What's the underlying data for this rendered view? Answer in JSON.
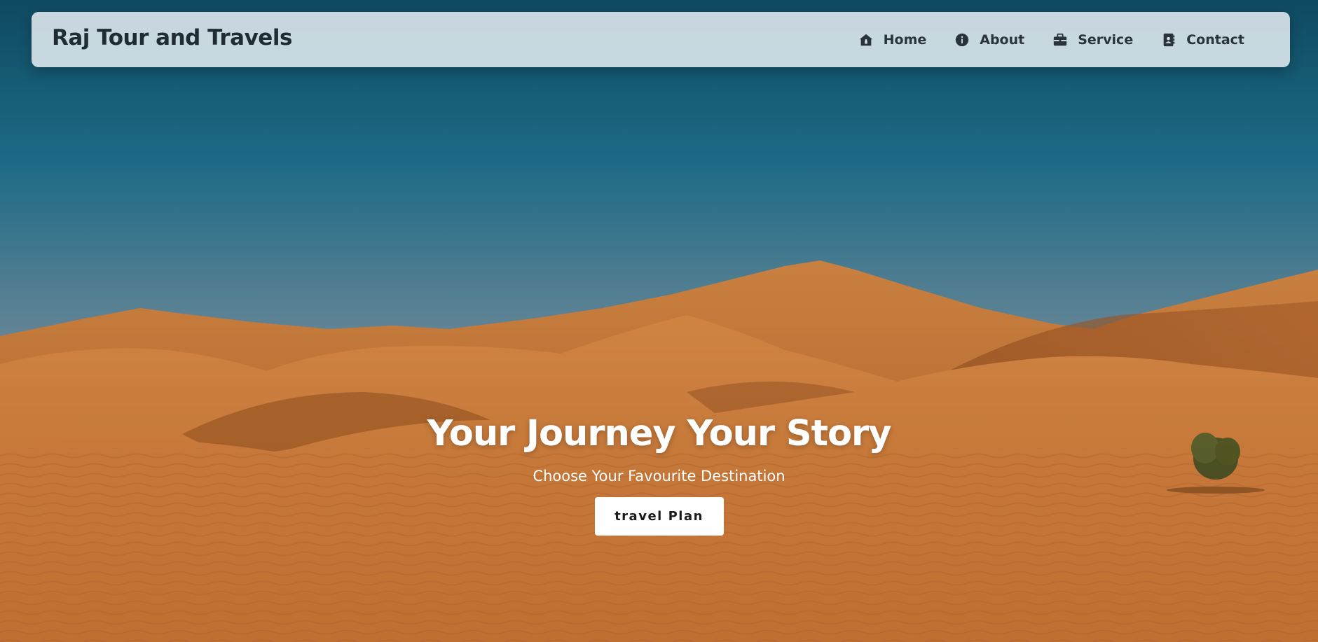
{
  "navbar": {
    "brand": "Raj Tour and Travels",
    "links": [
      {
        "label": "Home",
        "icon": "home-icon"
      },
      {
        "label": "About",
        "icon": "info-icon"
      },
      {
        "label": "Service",
        "icon": "briefcase-icon"
      },
      {
        "label": "Contact",
        "icon": "contact-book-icon"
      }
    ]
  },
  "hero": {
    "title": "Your Journey Your Story",
    "subtitle": "Choose Your Favourite Destination",
    "button_label": "travel Plan",
    "background": "desert-dunes-photo"
  },
  "colors": {
    "navbar_bg": "#d6e2e8",
    "text_dark": "#1f2d33",
    "sand": "#c8793c",
    "sky_top": "#0f4e66"
  }
}
